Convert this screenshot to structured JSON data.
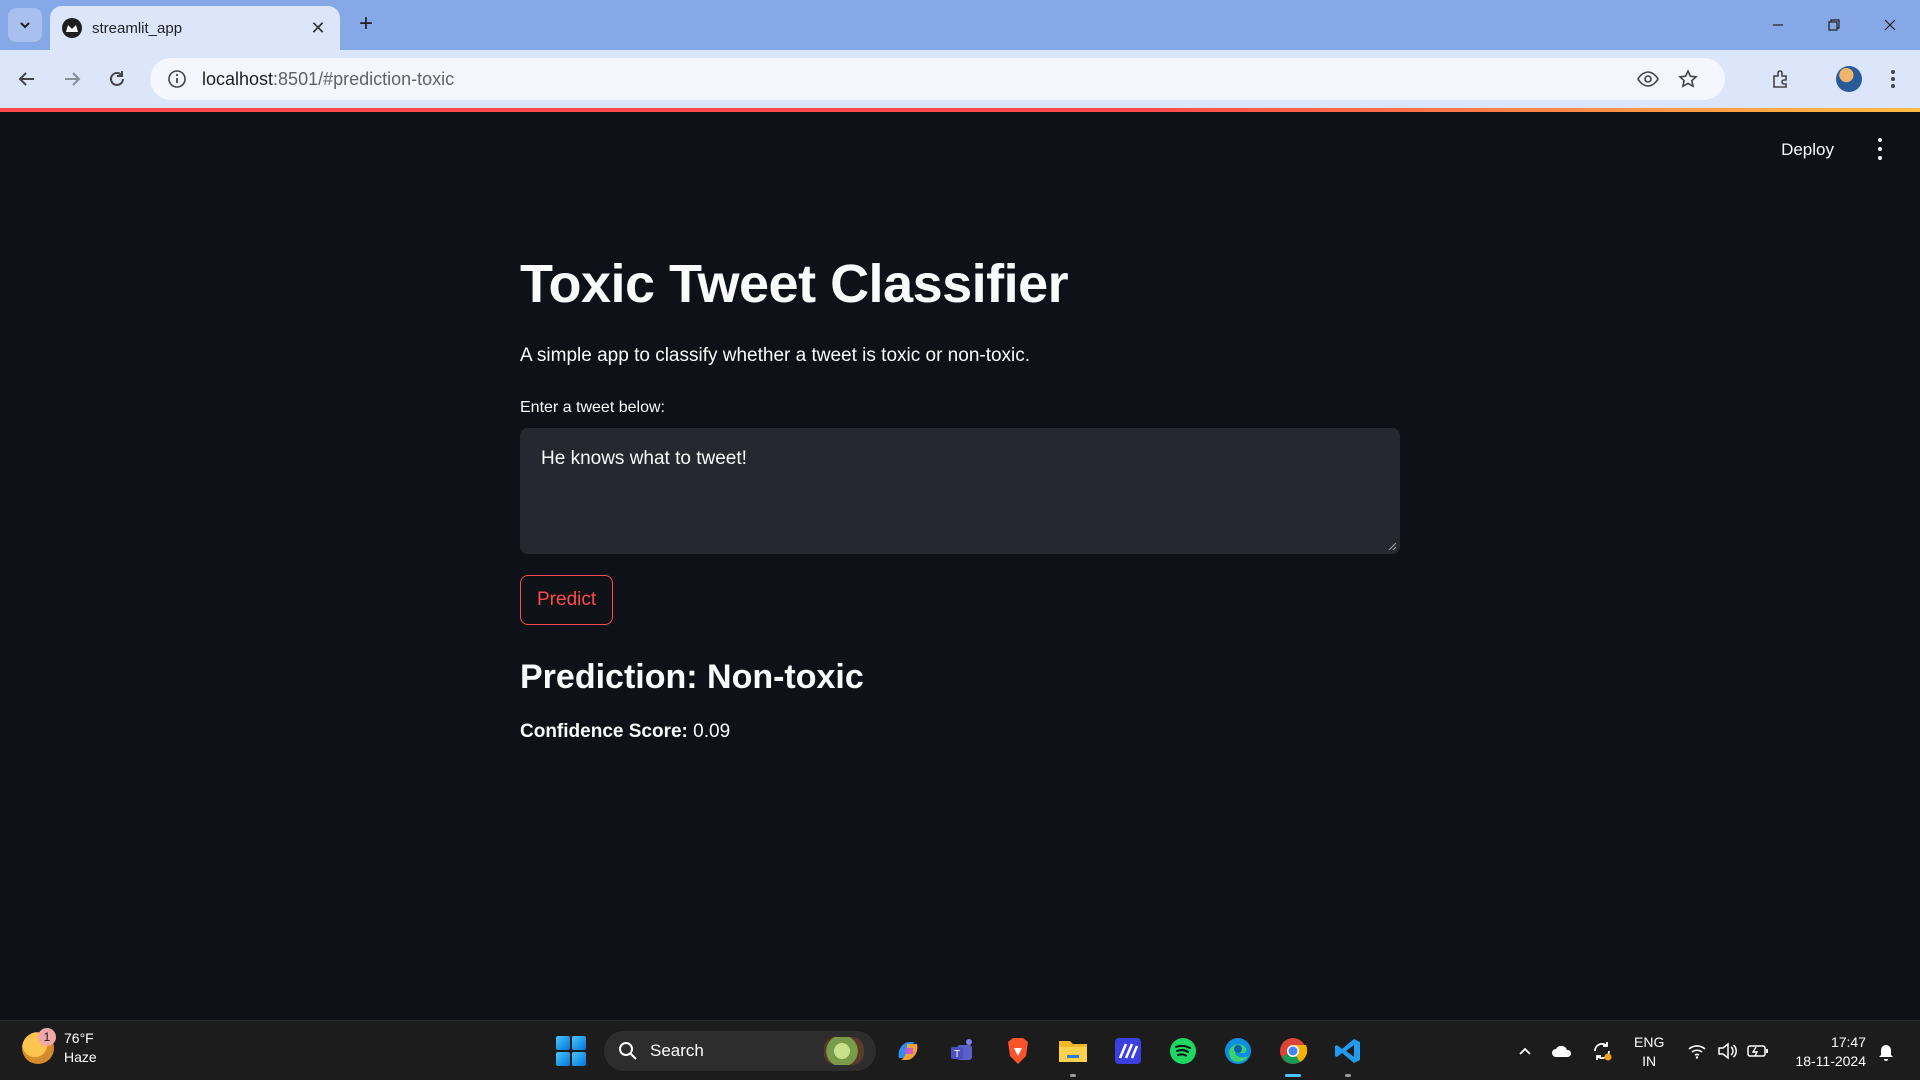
{
  "browser": {
    "tab_title": "streamlit_app",
    "url_host": "localhost",
    "url_rest": ":8501/#prediction-toxic"
  },
  "streamlit": {
    "deploy_label": "Deploy"
  },
  "app": {
    "title": "Toxic Tweet Classifier",
    "description": "A simple app to classify whether a tweet is toxic or non-toxic.",
    "input_label": "Enter a tweet below:",
    "input_value": "He knows what to tweet!",
    "button_label": "Predict",
    "prediction": "Prediction: Non-toxic",
    "confidence_label": "Confidence Score:",
    "confidence_value": " 0.09",
    "accent_color": "#ff4b4b"
  },
  "taskbar": {
    "weather_temp": "76°F",
    "weather_desc": "Haze",
    "weather_badge": "1",
    "search_label": "Search",
    "lang_top": "ENG",
    "lang_bottom": "IN",
    "time": "17:47",
    "date": "18-11-2024",
    "apps": [
      "copilot-icon",
      "teams-icon",
      "brave-icon",
      "file-explorer-icon",
      "mathpix-icon",
      "spotify-icon",
      "edge-icon",
      "chrome-icon",
      "vscode-icon"
    ]
  }
}
